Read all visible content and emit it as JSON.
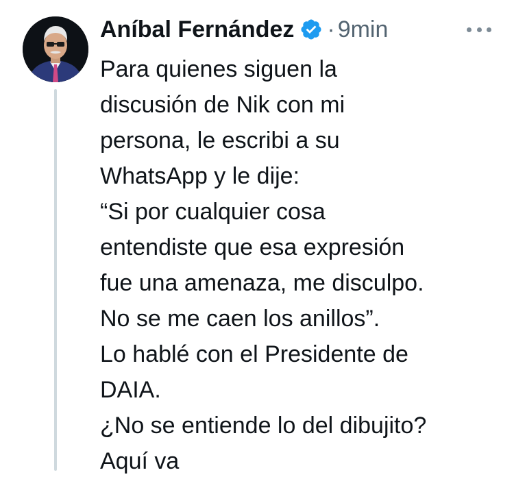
{
  "tweet": {
    "author_name": "Aníbal Fernández",
    "separator": "·",
    "time": "9min",
    "lines": [
      "Para quienes siguen la",
      "discusión de Nik con mi",
      "persona, le escribi a su",
      "WhatsApp y le dije:",
      "“Si por cualquier cosa",
      "entendiste que esa expresión",
      "fue una amenaza, me disculpo.",
      "No se me caen los anillos”.",
      "Lo hablé con el Presidente de",
      "DAIA.",
      "¿No se entiende lo del dibujito?",
      "Aquí va"
    ]
  },
  "icons": {
    "verified": "verified-badge-icon",
    "more": "more-options-icon"
  },
  "colors": {
    "verified_blue": "#1d9bf0",
    "text_primary": "#0f1419",
    "text_secondary": "#536471",
    "thread_line": "#cfd9de"
  }
}
